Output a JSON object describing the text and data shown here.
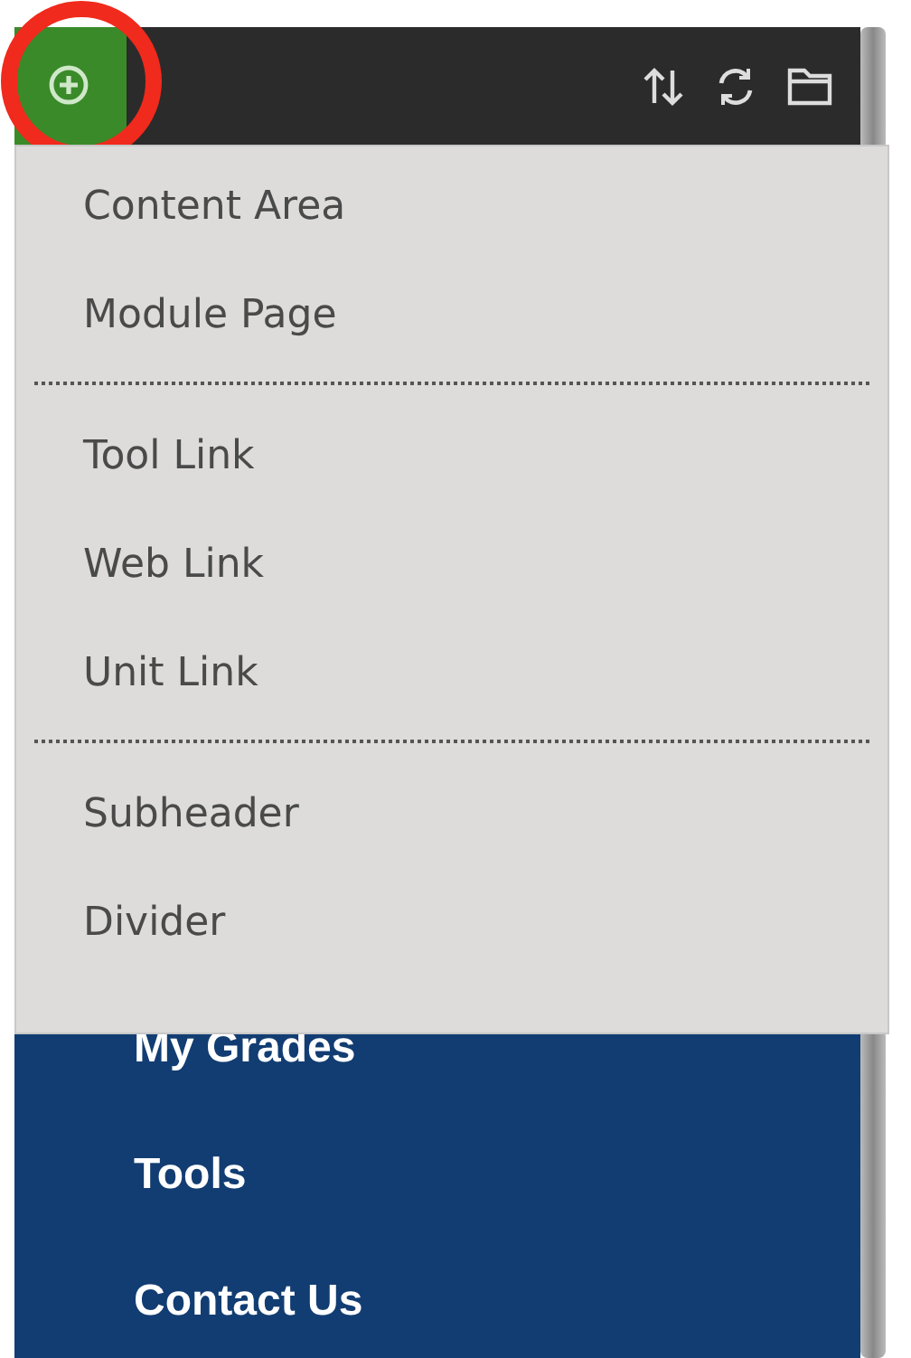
{
  "toolbar": {
    "add_button": {
      "selected": true,
      "highlighted": true
    }
  },
  "menu": {
    "groups": [
      {
        "items": [
          "Content Area",
          "Module Page"
        ]
      },
      {
        "items": [
          "Tool Link",
          "Web Link",
          "Unit Link"
        ]
      },
      {
        "items": [
          "Subheader",
          "Divider"
        ]
      }
    ]
  },
  "nav": {
    "items": [
      "My Grades",
      "Tools",
      "Contact Us"
    ]
  }
}
